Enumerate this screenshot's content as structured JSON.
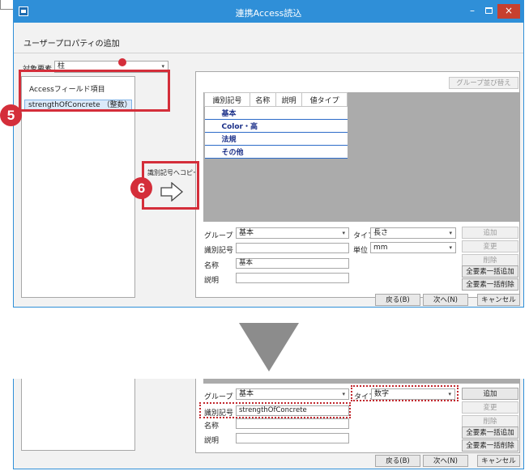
{
  "window": {
    "title": "連携Access読込",
    "page_title": "ユーザープロパティの追加"
  },
  "left_panel": {
    "target_label": "対象要素",
    "target_value": "柱",
    "list_header": "Accessフィールド項目",
    "items": [
      "strengthOfConcrete （整数）"
    ]
  },
  "badges": {
    "five": "5",
    "six": "6"
  },
  "copy_button": {
    "label": "識別記号へコピー"
  },
  "right_panel": {
    "group_reorder_button": "グループ並び替え",
    "table_headers": [
      "識別記号",
      "名称",
      "説明",
      "値タイプ"
    ],
    "groups": [
      "基本",
      "Color・高",
      "法規",
      "その他"
    ],
    "form": {
      "group_label": "グループ",
      "group_value": "基本",
      "type_label": "タイプ",
      "type_value": "長さ",
      "id_label": "識別記号",
      "id_value": "",
      "unit_label": "単位",
      "unit_value": "mm",
      "name_label": "名称",
      "name_value": "基本",
      "desc_label": "説明",
      "desc_value": ""
    },
    "buttons": {
      "add": "追加",
      "change": "変更",
      "delete": "削除",
      "add_all": "全要素一括追加",
      "delete_all": "全要素一括削除"
    }
  },
  "footer": {
    "back": "戻る(B)",
    "next": "次へ(N)",
    "cancel": "キャンセル"
  },
  "after": {
    "group_label": "グループ",
    "group_value": "基本",
    "type_label": "タイプ",
    "type_value": "数字",
    "id_label": "識別記号",
    "id_value": "strengthOfConcrete",
    "name_label": "名称",
    "desc_label": "説明",
    "buttons": {
      "add": "追加",
      "change": "変更",
      "delete": "削除",
      "add_all": "全要素一括追加",
      "delete_all": "全要素一括削除"
    },
    "footer": {
      "back": "戻る(B)",
      "next": "次へ(N)",
      "cancel": "キャンセル"
    }
  },
  "colors": {
    "titlebar": "#2f8fd8",
    "highlight_red": "#d42e3a",
    "grid_gray": "#ababab",
    "group_text": "#1a2f88"
  }
}
